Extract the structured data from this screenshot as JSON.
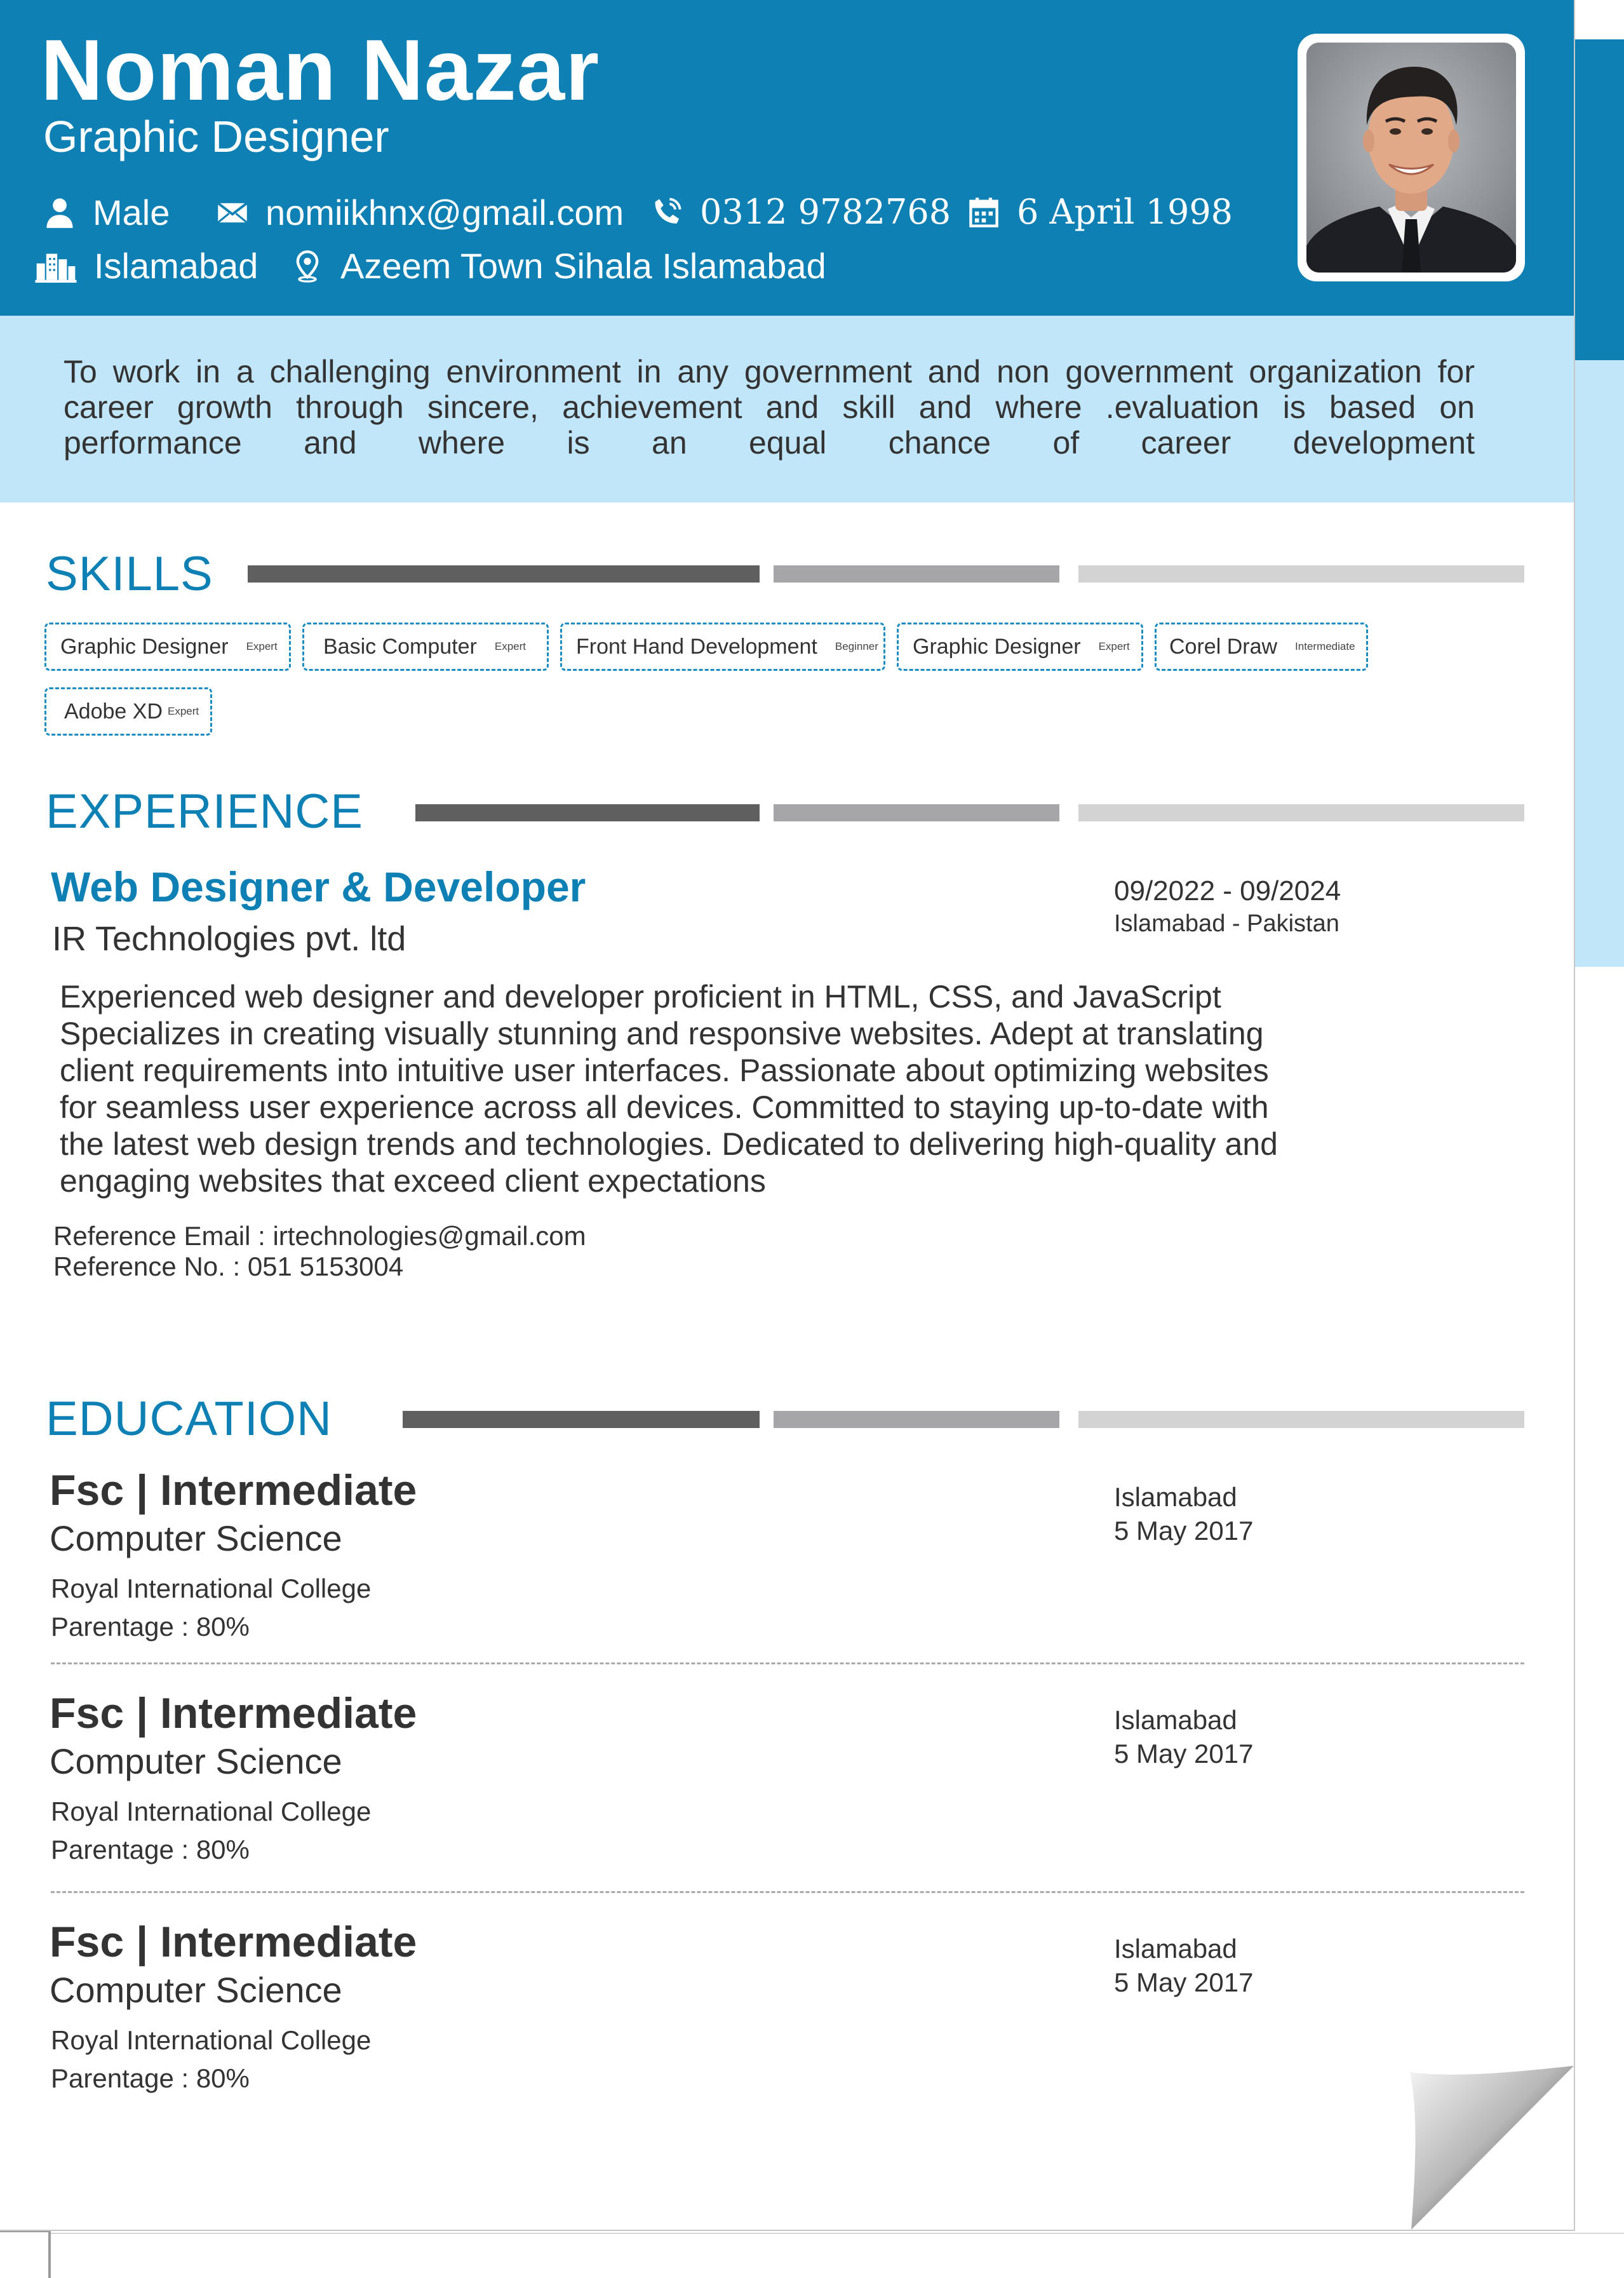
{
  "header": {
    "name": "Noman Nazar",
    "title": "Graphic Designer",
    "gender": "Male",
    "email": "nomiikhnx@gmail.com",
    "phone": "0312 9782768",
    "dob": "6 April 1998",
    "city": "Islamabad",
    "address": "Azeem Town Sihala Islamabad"
  },
  "objective": "To work in a challenging environment in any government and non government organization for career growth through sincere, achievement and skill and where .evaluation is based on performance and where is an equal chance of career development",
  "skills": {
    "heading": "SKILLS",
    "items": [
      {
        "name": "Graphic Designer",
        "level": "Expert"
      },
      {
        "name": "Basic Computer",
        "level": "Expert"
      },
      {
        "name": "Front Hand Development",
        "level": "Beginner"
      },
      {
        "name": "Graphic Designer",
        "level": "Expert"
      },
      {
        "name": "Corel Draw",
        "level": "Intermediate"
      },
      {
        "name": "Adobe XD",
        "level": "Expert"
      }
    ]
  },
  "experience": {
    "heading": "EXPERIENCE",
    "job_title": "Web Designer & Developer",
    "company": "IR Technologies pvt. ltd",
    "dates": "09/2022 - 09/2024",
    "location": "Islamabad - Pakistan",
    "description": [
      "Experienced web designer and developer proficient in  HTML, CSS, and JavaScript",
      "Specializes in creating  visually stunning and responsive websites. Adept at translating",
      "client requirements into intuitive user interfaces. Passionate about optimizing websites",
      "for seamless user experience across all devices. Committed to staying up-to-date with",
      "the latest web design trends and technologies. Dedicated to delivering high-quality and",
      "engaging websites that exceed client expectations"
    ],
    "ref_email": "Reference Email : irtechnologies@gmail.com",
    "ref_no": "Reference No. : 051 5153004"
  },
  "education": {
    "heading": "EDUCATION",
    "items": [
      {
        "degree": "Fsc | Intermediate",
        "field": "Computer Science",
        "school": "Royal International College",
        "percentage": "Parentage : 80%",
        "city": "Islamabad",
        "date": "5 May 2017"
      },
      {
        "degree": "Fsc | Intermediate",
        "field": "Computer Science",
        "school": "Royal International College",
        "percentage": "Parentage : 80%",
        "city": "Islamabad",
        "date": "5 May 2017"
      },
      {
        "degree": "Fsc | Intermediate",
        "field": "Computer Science",
        "school": "Royal International College",
        "percentage": "Parentage : 80%",
        "city": "Islamabad",
        "date": "5 May 2017"
      }
    ]
  },
  "colors": {
    "accent": "#0e80b4",
    "light_band": "#c1e6f9",
    "bar_dark": "#5f5f5f",
    "bar_mid": "#a6a6a8",
    "bar_light": "#d3d3d4"
  }
}
